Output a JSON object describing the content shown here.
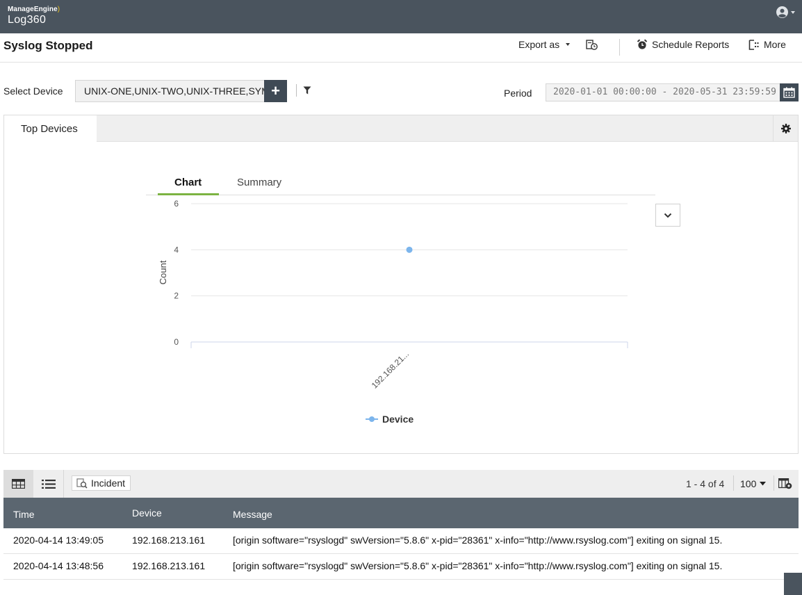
{
  "header": {
    "brand_company": "ManageEngine",
    "brand_product": "Log360",
    "user_icon": "user-circle-icon"
  },
  "page": {
    "title": "Syslog Stopped",
    "actions": {
      "export_label": "Export as",
      "schedule_label": "Schedule Reports",
      "more_label": "More"
    }
  },
  "filters": {
    "device_label": "Select Device",
    "device_value": "UNIX-ONE,UNIX-TWO,UNIX-THREE,SYMPHONY",
    "add_label": "+",
    "period_label": "Period",
    "period_value": "2020-01-01 00:00:00 - 2020-05-31 23:59:59"
  },
  "panel": {
    "tab_label": "Top Devices",
    "chart_tabs": [
      "Chart",
      "Summary"
    ],
    "active_chart_tab": "Chart"
  },
  "chart_data": {
    "type": "line",
    "categories": [
      "192.168.21..."
    ],
    "series": [
      {
        "name": "Device",
        "values": [
          4
        ],
        "color": "#7cb5ec"
      }
    ],
    "ylabel": "Count",
    "xlabel": "",
    "ylim": [
      0,
      6
    ],
    "yticks": [
      0,
      2,
      4,
      6
    ],
    "grid": true,
    "legend": "bottom-center"
  },
  "table": {
    "toolbar": {
      "incident_label": "Incident",
      "pager_text": "1 - 4 of 4",
      "per_page": "100"
    },
    "columns": [
      "Time",
      "Device",
      "Message"
    ],
    "rows": [
      {
        "time": "2020-04-14 13:49:05",
        "device": "192.168.213.161",
        "message": "[origin software=\"rsyslogd\" swVersion=\"5.8.6\" x-pid=\"28361\" x-info=\"http://www.rsyslog.com\"] exiting on signal 15."
      },
      {
        "time": "2020-04-14 13:48:56",
        "device": "192.168.213.161",
        "message": "[origin software=\"rsyslogd\" swVersion=\"5.8.6\" x-pid=\"28361\" x-info=\"http://www.rsyslog.com\"] exiting on signal 15."
      }
    ]
  }
}
